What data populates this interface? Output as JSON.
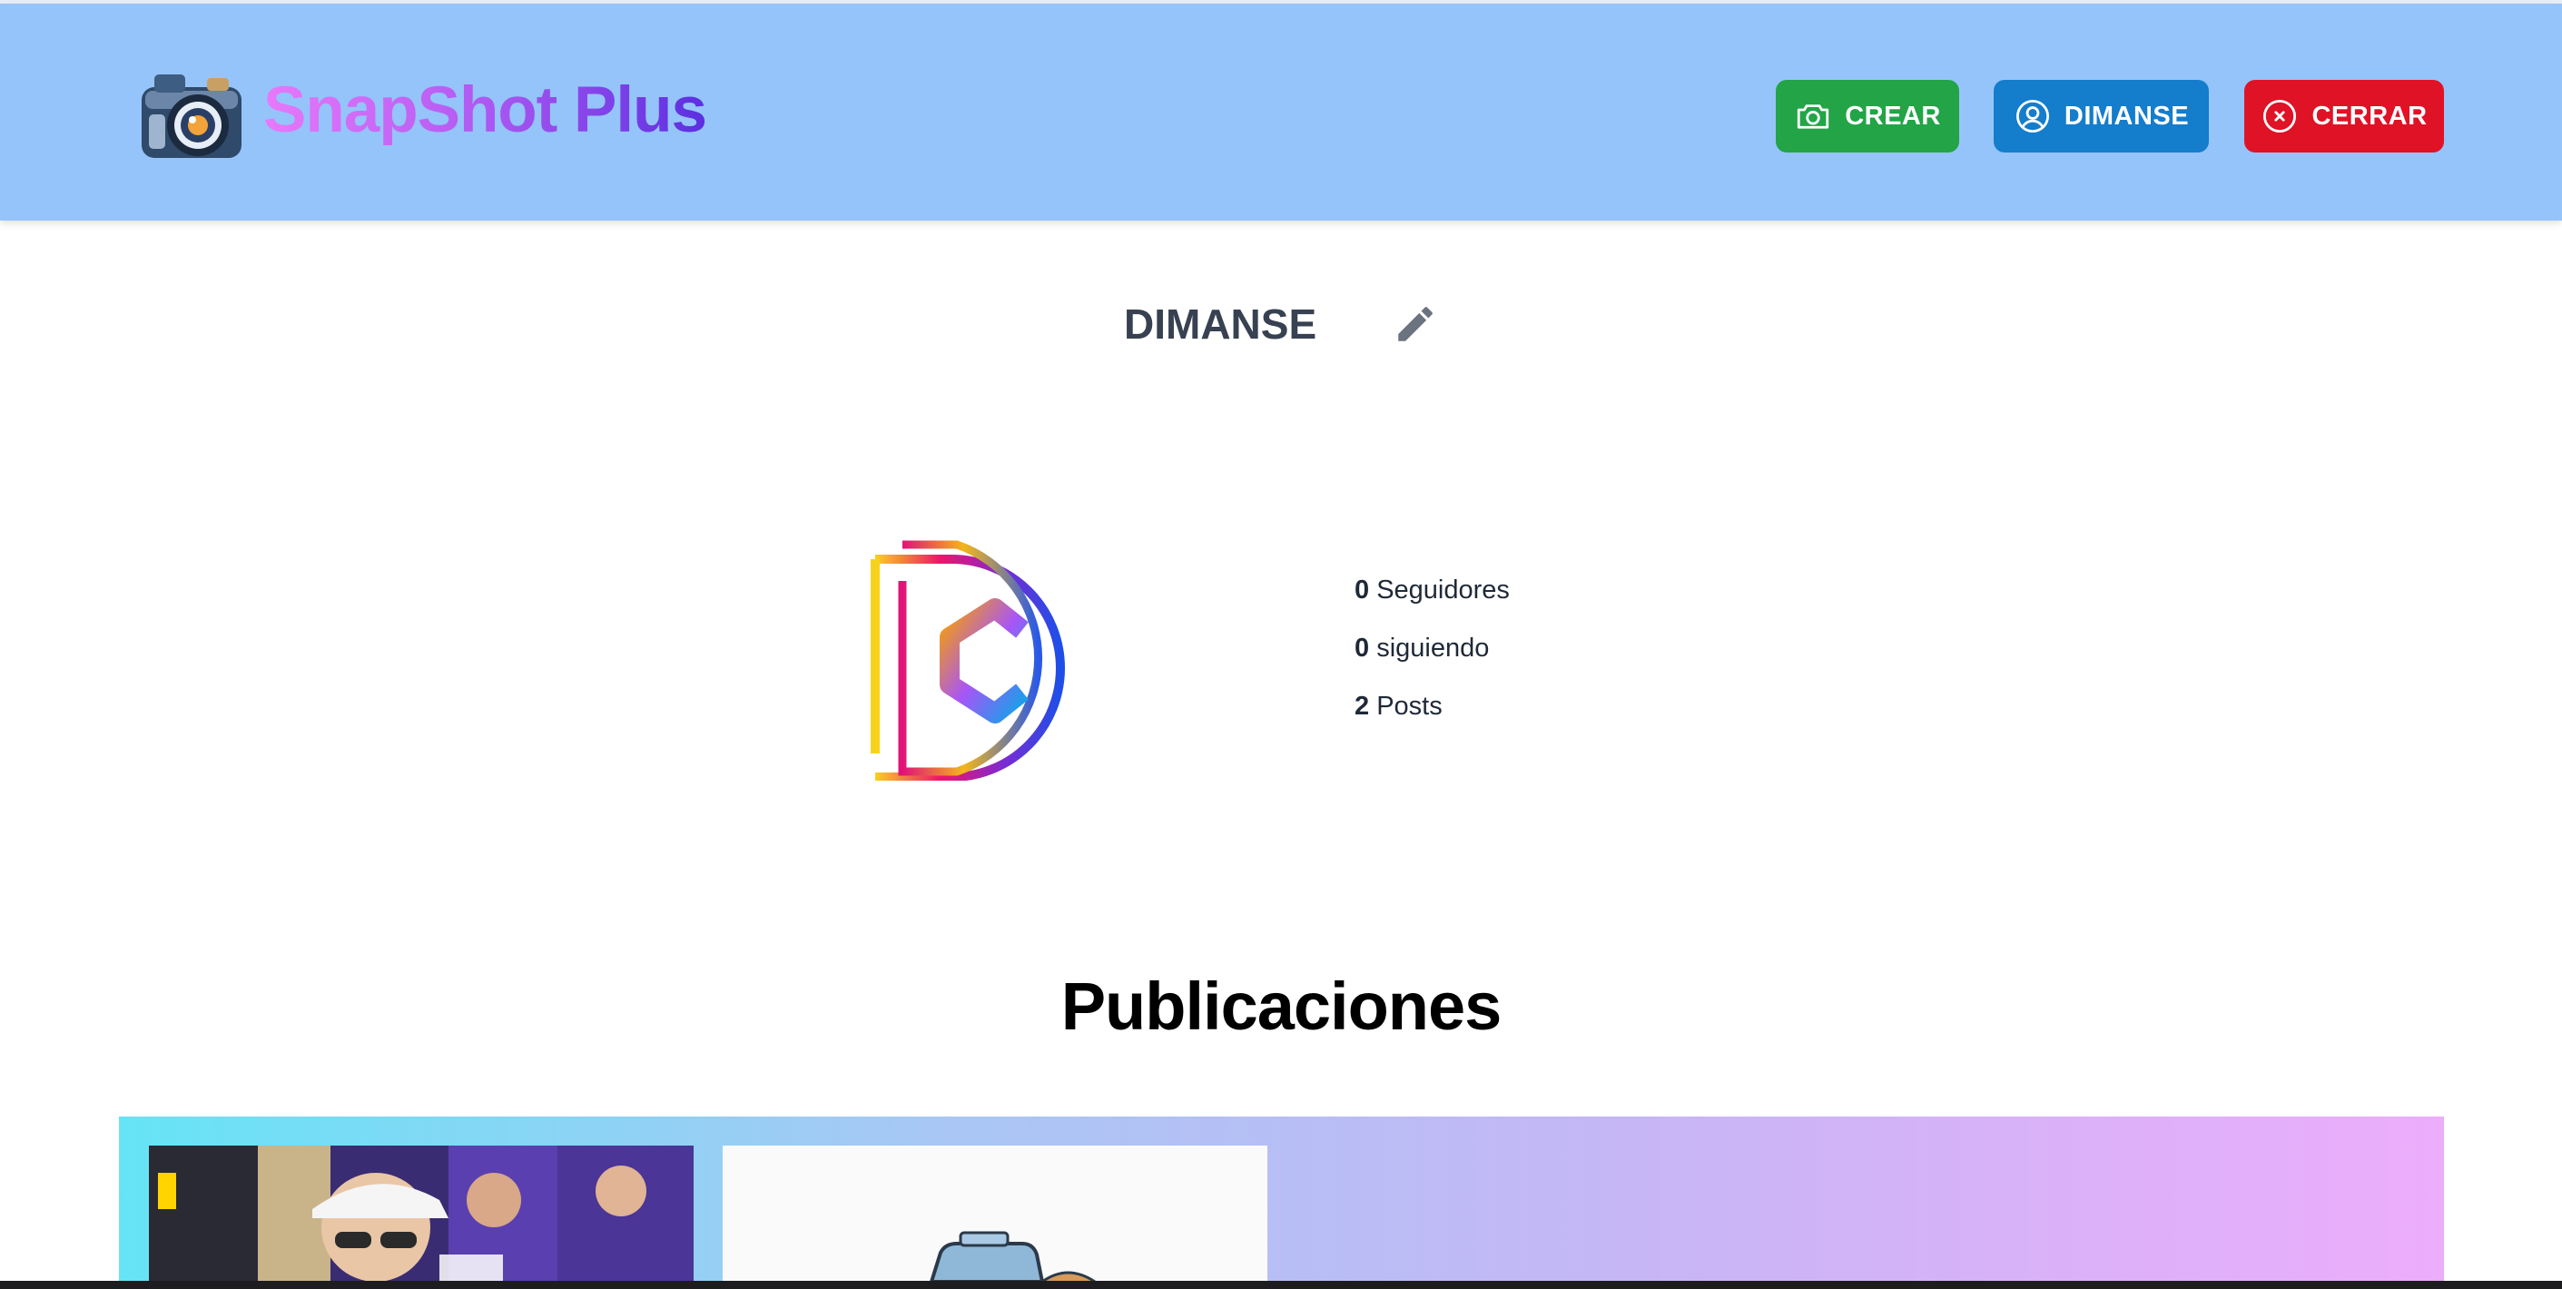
{
  "header": {
    "brand": "SnapShot Plus",
    "buttons": {
      "create_label": "CREAR",
      "user_label": "DIMANSE",
      "logout_label": "CERRAR"
    },
    "colors": {
      "background": "#95c4fa",
      "create": "#22a447",
      "user": "#147dcc",
      "logout": "#e01226"
    }
  },
  "profile": {
    "username": "DIMANSE",
    "stats": [
      {
        "value": "0",
        "label": "Seguidores"
      },
      {
        "value": "0",
        "label": "siguiendo"
      },
      {
        "value": "2",
        "label": "Posts"
      }
    ]
  },
  "posts": {
    "title": "Publicaciones"
  }
}
